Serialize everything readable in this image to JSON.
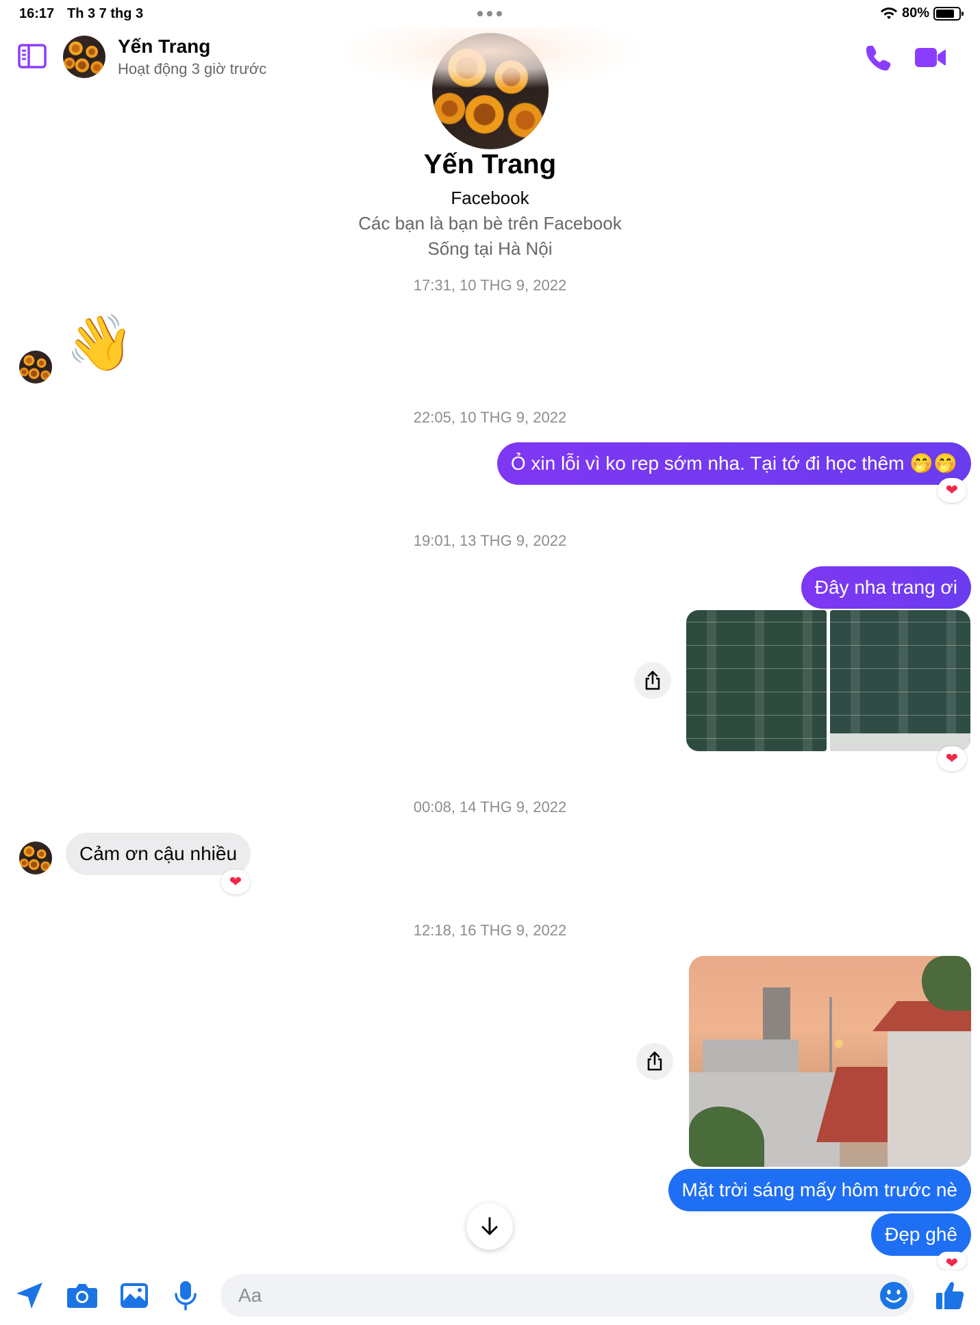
{
  "status_bar": {
    "time": "16:17",
    "date": "Th 3 7 thg 3",
    "battery": "80%",
    "battery_level": 0.8
  },
  "header": {
    "name": "Yến Trang",
    "status": "Hoạt động 3 giờ trước"
  },
  "profile": {
    "name": "Yến Trang",
    "source": "Facebook",
    "friends": "Các bạn là bạn bè trên Facebook",
    "location": "Sống tại Hà Nội"
  },
  "messages": {
    "ts1": "17:31, 10 THG 9, 2022",
    "wave": "👋",
    "ts2": "22:05, 10 THG 9, 2022",
    "apology": "Ỏ xin lỗi vì ko rep sớm nha. Tại tớ đi học thêm 🤭🤭",
    "ts3": "19:01, 13 THG 9, 2022",
    "here": "Đây nha trang ơi",
    "ts4": "00:08, 14 THG 9, 2022",
    "thanks": "Cảm ơn cậu nhiều",
    "ts5": "12:18, 16 THG 9, 2022",
    "sun": "Mặt trời sáng mấy hôm trước nè",
    "pretty": "Đẹp ghê",
    "reaction": "❤"
  },
  "composer": {
    "placeholder": "Aa"
  },
  "colors": {
    "accent": "#7f37f2",
    "blue": "#1f6ff5",
    "incoming": "#ececee",
    "heart": "#f02849"
  },
  "icons": [
    "sidebar-icon",
    "phone-icon",
    "video-icon",
    "share-icon",
    "arrow-down-icon",
    "send-location-icon",
    "camera-icon",
    "gallery-icon",
    "mic-icon",
    "emoji-icon",
    "thumbs-up-icon"
  ]
}
